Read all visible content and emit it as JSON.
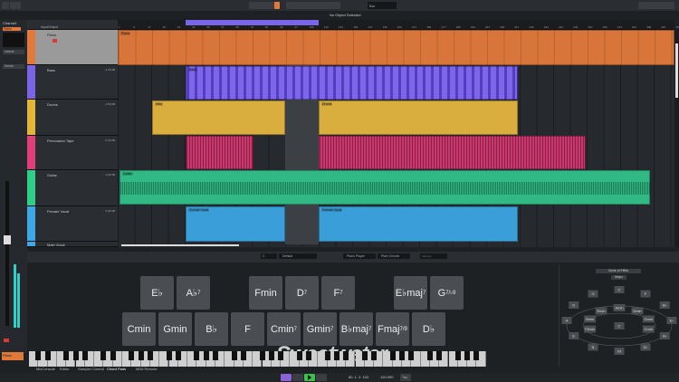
{
  "toolbar": {
    "info": "No Object Selected",
    "grid": "Bar"
  },
  "inspector": {
    "title": "Channel",
    "track": "Piano",
    "sections": [
      "Inserts",
      "Sends"
    ]
  },
  "tracklist": {
    "header": "Input/Output",
    "tracks": [
      {
        "name": "Piano",
        "color": "#e0793a",
        "volume": "0.00 dB"
      },
      {
        "name": "Bass",
        "color": "#7b64e6",
        "volume": "-1.25 dB"
      },
      {
        "name": "Drums",
        "color": "#e3b53a",
        "volume": "-1.50 dB"
      },
      {
        "name": "Percussion Tape",
        "color": "#e0407a",
        "volume": "-6.40 dB"
      },
      {
        "name": "Guitar",
        "color": "#2fcf8a",
        "volume": "0.00 dB"
      },
      {
        "name": "Female Vocal",
        "color": "#3ea8e6",
        "volume": "0.00 dB"
      },
      {
        "name": "Male Vocal",
        "color": "#3ea8e6",
        "volume": "0.00 dB"
      }
    ]
  },
  "ruler": [
    "1",
    "9",
    "17",
    "25",
    "33",
    "41",
    "49",
    "57",
    "65",
    "73",
    "81",
    "89",
    "97",
    "105",
    "113",
    "121",
    "129",
    "137",
    "145",
    "153",
    "161",
    "169",
    "177",
    "185",
    "193",
    "201",
    "209",
    "217",
    "225",
    "233",
    "241",
    "249",
    "257",
    "265",
    "273",
    "281",
    "289",
    "297",
    "305"
  ],
  "events": {
    "piano": "Piano",
    "intro": "Intro",
    "drums": "Drums",
    "guitar": "Guitar",
    "vocal": "Female Vocal",
    "male": "Male Vocal",
    "bass": "Bass"
  },
  "chordpads": {
    "toolbar": {
      "key": "C",
      "preset": "Default",
      "player": "Piano Player",
      "voicing": "Plain Chords",
      "velocity": "Velocity"
    },
    "row1": [
      {
        "root": "E♭",
        "ext": ""
      },
      {
        "root": "A♭",
        "ext": "7"
      },
      {
        "root": "Fmin",
        "ext": ""
      },
      {
        "root": "D",
        "ext": "7"
      },
      {
        "root": "F",
        "ext": "7"
      },
      {
        "root": "E♭maj",
        "ext": "7"
      },
      {
        "root": "G",
        "ext": "7/♭9"
      }
    ],
    "row2": [
      {
        "root": "Cmin",
        "ext": ""
      },
      {
        "root": "Gmin",
        "ext": ""
      },
      {
        "root": "B♭",
        "ext": ""
      },
      {
        "root": "F",
        "ext": ""
      },
      {
        "root": "Cmin",
        "ext": "7"
      },
      {
        "root": "Gmin",
        "ext": "7"
      },
      {
        "root": "B♭maj",
        "ext": "7"
      },
      {
        "root": "Fmaj",
        "ext": "7/9"
      },
      {
        "root": "D♭",
        "ext": ""
      }
    ]
  },
  "circle": {
    "mode": "Circle of Fifths",
    "scale": "Major",
    "center": "C",
    "outer": [
      "C",
      "F",
      "G",
      "B♭",
      "D",
      "E♭",
      "A",
      "A♭",
      "E",
      "D♭",
      "B",
      "F♯"
    ],
    "inner": [
      "Amin",
      "Dmin",
      "Emin",
      "Gmin",
      "Bmin",
      "Cmin",
      "F♯min"
    ]
  },
  "tabs": [
    "MixConsole",
    "Editor",
    "Sampler Control",
    "Chord Pads",
    "MIDI Remote"
  ],
  "transport": {
    "position": "80. 1. 2. 102",
    "tempo": "120.000",
    "tap": "Tap"
  },
  "watermark": "Sweetwater"
}
